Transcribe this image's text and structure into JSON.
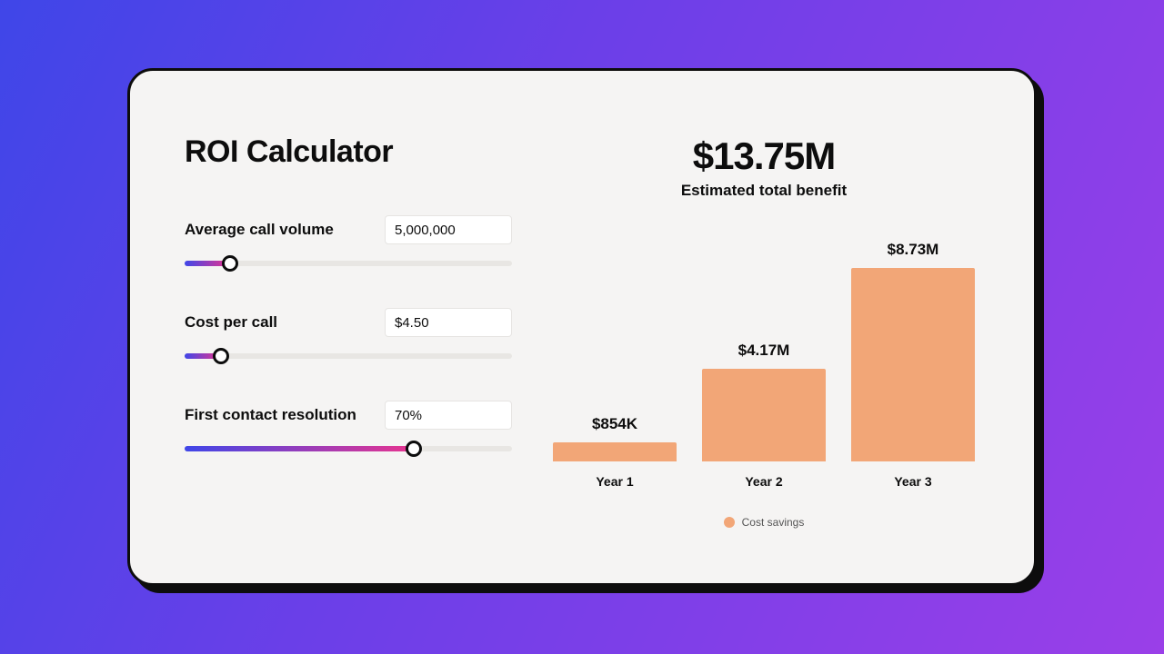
{
  "title": "ROI Calculator",
  "controls": [
    {
      "label": "Average call volume",
      "value": "5,000,000",
      "pct": 14
    },
    {
      "label": "Cost per call",
      "value": "$4.50",
      "pct": 11
    },
    {
      "label": "First contact resolution",
      "value": "70%",
      "pct": 70
    }
  ],
  "summary": {
    "value": "$13.75M",
    "label": "Estimated total benefit"
  },
  "legend": "Cost savings",
  "chart_data": {
    "type": "bar",
    "title": "Estimated total benefit",
    "ylabel": "Cost savings",
    "categories": [
      "Year 1",
      "Year 2",
      "Year 3"
    ],
    "series": [
      {
        "name": "Cost savings",
        "values_display": [
          "$854K",
          "$4.17M",
          "$8.73M"
        ],
        "values": [
          0.854,
          4.17,
          8.73
        ]
      }
    ],
    "ylim": [
      0,
      9
    ],
    "total_display": "$13.75M",
    "total": 13.75,
    "unit": "$M"
  }
}
